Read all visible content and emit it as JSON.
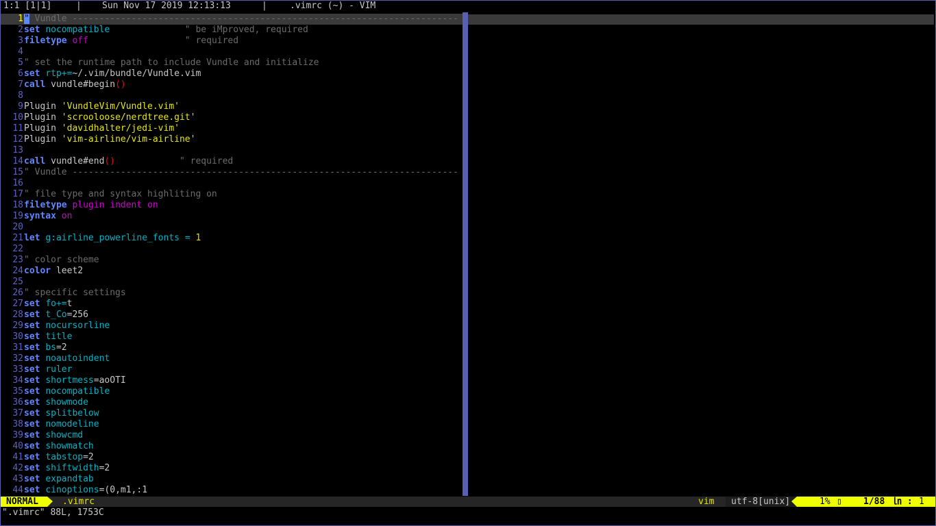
{
  "titlebar": {
    "position": "1:1 [1|1]",
    "sep1": "|",
    "datetime": "Sun Nov 17 2019 12:13:13",
    "sep2": "|",
    "window_title": ".vimrc (~) - VIM"
  },
  "lines": [
    [
      {
        "t": "\"",
        "c": "cursor"
      },
      {
        "t": " Vundle ------------------------------------------------------------------------",
        "c": "cm"
      }
    ],
    [
      {
        "t": "set",
        "c": "kw"
      },
      {
        "t": " ",
        "c": "plain"
      },
      {
        "t": "nocompatible",
        "c": "opt"
      },
      {
        "t": "              \" be iMproved, required",
        "c": "cm"
      }
    ],
    [
      {
        "t": "filetype",
        "c": "kw"
      },
      {
        "t": " ",
        "c": "plain"
      },
      {
        "t": "off",
        "c": "val"
      },
      {
        "t": "                  \" required",
        "c": "cm"
      }
    ],
    [],
    [
      {
        "t": "\" set the runtime path to include Vundle and initialize",
        "c": "cm"
      }
    ],
    [
      {
        "t": "set",
        "c": "kw"
      },
      {
        "t": " ",
        "c": "plain"
      },
      {
        "t": "rtp",
        "c": "opt"
      },
      {
        "t": "+=",
        "c": "opr"
      },
      {
        "t": "~/.vim/bundle/Vundle.vim",
        "c": "plain"
      }
    ],
    [
      {
        "t": "call",
        "c": "kw"
      },
      {
        "t": " vundle#begin",
        "c": "plain"
      },
      {
        "t": "()",
        "c": "par"
      }
    ],
    [],
    [
      {
        "t": "Plugin ",
        "c": "plain"
      },
      {
        "t": "'VundleVim/Vundle.vim'",
        "c": "str"
      }
    ],
    [
      {
        "t": "Plugin ",
        "c": "plain"
      },
      {
        "t": "'scrooloose/nerdtree.git'",
        "c": "str"
      }
    ],
    [
      {
        "t": "Plugin ",
        "c": "plain"
      },
      {
        "t": "'davidhalter/jedi-vim'",
        "c": "str"
      }
    ],
    [
      {
        "t": "Plugin ",
        "c": "plain"
      },
      {
        "t": "'vim-airline/vim-airline'",
        "c": "str"
      }
    ],
    [],
    [
      {
        "t": "call",
        "c": "kw"
      },
      {
        "t": " vundle#end",
        "c": "plain"
      },
      {
        "t": "()",
        "c": "par"
      },
      {
        "t": "            \" required",
        "c": "cm"
      }
    ],
    [
      {
        "t": "\" Vundle ------------------------------------------------------------------------",
        "c": "cm"
      }
    ],
    [],
    [
      {
        "t": "\" file type and syntax highliting on",
        "c": "cm"
      }
    ],
    [
      {
        "t": "filetype",
        "c": "kw"
      },
      {
        "t": " ",
        "c": "plain"
      },
      {
        "t": "plugin",
        "c": "val"
      },
      {
        "t": " ",
        "c": "plain"
      },
      {
        "t": "indent",
        "c": "val"
      },
      {
        "t": " ",
        "c": "plain"
      },
      {
        "t": "on",
        "c": "val"
      }
    ],
    [
      {
        "t": "syntax",
        "c": "kw"
      },
      {
        "t": " ",
        "c": "plain"
      },
      {
        "t": "on",
        "c": "val"
      }
    ],
    [],
    [
      {
        "t": "let",
        "c": "kw"
      },
      {
        "t": " ",
        "c": "plain"
      },
      {
        "t": "g:airline_powerline_fonts",
        "c": "opt"
      },
      {
        "t": " ",
        "c": "plain"
      },
      {
        "t": "=",
        "c": "opr"
      },
      {
        "t": " ",
        "c": "plain"
      },
      {
        "t": "1",
        "c": "num"
      }
    ],
    [],
    [
      {
        "t": "\" color scheme",
        "c": "cm"
      }
    ],
    [
      {
        "t": "color",
        "c": "kw"
      },
      {
        "t": " leet2",
        "c": "plain"
      }
    ],
    [],
    [
      {
        "t": "\" specific settings",
        "c": "cm"
      }
    ],
    [
      {
        "t": "set",
        "c": "kw"
      },
      {
        "t": " ",
        "c": "plain"
      },
      {
        "t": "fo",
        "c": "opt"
      },
      {
        "t": "+=",
        "c": "opr"
      },
      {
        "t": "t",
        "c": "plain"
      }
    ],
    [
      {
        "t": "set",
        "c": "kw"
      },
      {
        "t": " ",
        "c": "plain"
      },
      {
        "t": "t_Co",
        "c": "opt"
      },
      {
        "t": "=256",
        "c": "plain"
      }
    ],
    [
      {
        "t": "set",
        "c": "kw"
      },
      {
        "t": " ",
        "c": "plain"
      },
      {
        "t": "nocursorline",
        "c": "opt"
      }
    ],
    [
      {
        "t": "set",
        "c": "kw"
      },
      {
        "t": " ",
        "c": "plain"
      },
      {
        "t": "title",
        "c": "opt"
      }
    ],
    [
      {
        "t": "set",
        "c": "kw"
      },
      {
        "t": " ",
        "c": "plain"
      },
      {
        "t": "bs",
        "c": "opt"
      },
      {
        "t": "=2",
        "c": "plain"
      }
    ],
    [
      {
        "t": "set",
        "c": "kw"
      },
      {
        "t": " ",
        "c": "plain"
      },
      {
        "t": "noautoindent",
        "c": "opt"
      }
    ],
    [
      {
        "t": "set",
        "c": "kw"
      },
      {
        "t": " ",
        "c": "plain"
      },
      {
        "t": "ruler",
        "c": "opt"
      }
    ],
    [
      {
        "t": "set",
        "c": "kw"
      },
      {
        "t": " ",
        "c": "plain"
      },
      {
        "t": "shortmess",
        "c": "opt"
      },
      {
        "t": "=aoOTI",
        "c": "plain"
      }
    ],
    [
      {
        "t": "set",
        "c": "kw"
      },
      {
        "t": " ",
        "c": "plain"
      },
      {
        "t": "nocompatible",
        "c": "opt"
      }
    ],
    [
      {
        "t": "set",
        "c": "kw"
      },
      {
        "t": " ",
        "c": "plain"
      },
      {
        "t": "showmode",
        "c": "opt"
      }
    ],
    [
      {
        "t": "set",
        "c": "kw"
      },
      {
        "t": " ",
        "c": "plain"
      },
      {
        "t": "splitbelow",
        "c": "opt"
      }
    ],
    [
      {
        "t": "set",
        "c": "kw"
      },
      {
        "t": " ",
        "c": "plain"
      },
      {
        "t": "nomodeline",
        "c": "opt"
      }
    ],
    [
      {
        "t": "set",
        "c": "kw"
      },
      {
        "t": " ",
        "c": "plain"
      },
      {
        "t": "showcmd",
        "c": "opt"
      }
    ],
    [
      {
        "t": "set",
        "c": "kw"
      },
      {
        "t": " ",
        "c": "plain"
      },
      {
        "t": "showmatch",
        "c": "opt"
      }
    ],
    [
      {
        "t": "set",
        "c": "kw"
      },
      {
        "t": " ",
        "c": "plain"
      },
      {
        "t": "tabstop",
        "c": "opt"
      },
      {
        "t": "=2",
        "c": "plain"
      }
    ],
    [
      {
        "t": "set",
        "c": "kw"
      },
      {
        "t": " ",
        "c": "plain"
      },
      {
        "t": "shiftwidth",
        "c": "opt"
      },
      {
        "t": "=2",
        "c": "plain"
      }
    ],
    [
      {
        "t": "set",
        "c": "kw"
      },
      {
        "t": " ",
        "c": "plain"
      },
      {
        "t": "expandtab",
        "c": "opt"
      }
    ],
    [
      {
        "t": "set",
        "c": "kw"
      },
      {
        "t": " ",
        "c": "plain"
      },
      {
        "t": "cinoptions",
        "c": "opt"
      },
      {
        "t": "=(0,m1,:1",
        "c": "plain"
      }
    ]
  ],
  "current_line": 1,
  "statusline": {
    "mode": "NORMAL",
    "filename": ".vimrc",
    "filetype": "vim",
    "encoding": "utf-8[unix]",
    "percent": "1%",
    "line_info": "1/88",
    "col_label": "㏑ :",
    "col": "1"
  },
  "cmdline": "\".vimrc\" 88L, 1753C",
  "colors": {
    "background": "#000000",
    "line_number": "#5d62c8",
    "current_line_number": "#ffff00",
    "keyword": "#5f87ff",
    "option": "#00b4c8",
    "comment": "#6b6b6b",
    "string": "#e6e600",
    "mode_bg": "#f0ff00",
    "split": "#5b5fb4"
  }
}
